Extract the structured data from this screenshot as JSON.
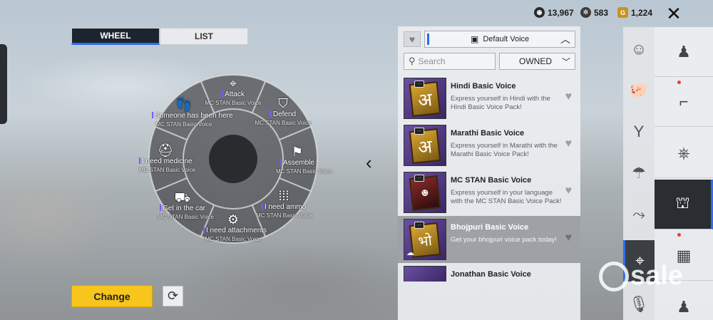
{
  "tabs": {
    "wheel": "WHEEL",
    "list": "LIST"
  },
  "currency": [
    {
      "icon": "uc-coin-icon",
      "value": "13,967"
    },
    {
      "icon": "ag-coin-icon",
      "value": "583"
    },
    {
      "icon": "gold-coin-icon",
      "value": "1,224"
    }
  ],
  "wheel_slots": [
    {
      "label": "Attack",
      "sub": "MC STAN Basic Voice",
      "icon": "crosshair-icon"
    },
    {
      "label": "Defend",
      "sub": "MC STAN Basic Voice",
      "icon": "shield-icon"
    },
    {
      "label": "Assemble",
      "sub": "MC STAN Basic Voice",
      "icon": "flag-icon"
    },
    {
      "label": "I need ammo",
      "sub": "MC STAN Basic Voice",
      "icon": "ammo-icon"
    },
    {
      "label": "I need attachments",
      "sub": "MC STAN Basic Voice",
      "icon": "attachment-icon"
    },
    {
      "label": "Get in the car",
      "sub": "MC STAN Basic Voice",
      "icon": "car-seat-icon"
    },
    {
      "label": "I need medicine",
      "sub": "MC STAN Basic Voice",
      "icon": "medkit-icon"
    },
    {
      "label": "Someone has been here",
      "sub": "MC STAN Basic Voice",
      "icon": "footprints-icon"
    }
  ],
  "buttons": {
    "change": "Change"
  },
  "panel": {
    "voice_select": "Default Voice",
    "search_placeholder": "Search",
    "filter": "OWNED",
    "voices": [
      {
        "title": "Hindi Basic Voice",
        "desc": "Express yourself in Hindi with the Hindi Basic Voice Pack!",
        "glyph": "अ"
      },
      {
        "title": "Marathi Basic Voice",
        "desc": "Express yourself in Marathi with the Marathi Basic Voice Pack!",
        "glyph": "अ"
      },
      {
        "title": "MC STAN Basic Voice",
        "desc": "Express yourself in your language with the MC STAN Basic Voice Pack!",
        "glyph": ""
      },
      {
        "title": "Bhojpuri Basic Voice",
        "desc": "Get your bhojpuri voice pack today!",
        "glyph": "भो"
      },
      {
        "title": "Jonathan Basic Voice",
        "desc": "",
        "glyph": ""
      }
    ]
  },
  "rail_icons": [
    "emote-icon",
    "pig-icon",
    "slingshot-icon",
    "parachute-icon",
    "prone-icon",
    "location-pin-icon",
    "microphone-icon"
  ],
  "subrail_icons": [
    "character-icon",
    "pistol-icon",
    "steering-wheel-icon",
    "helmet-icon",
    "crate-icon",
    "character-icon"
  ],
  "watermark": "sale",
  "colors": {
    "accent": "#2c6cf0",
    "button": "#f7c51b",
    "purple": "#7f57ff"
  }
}
